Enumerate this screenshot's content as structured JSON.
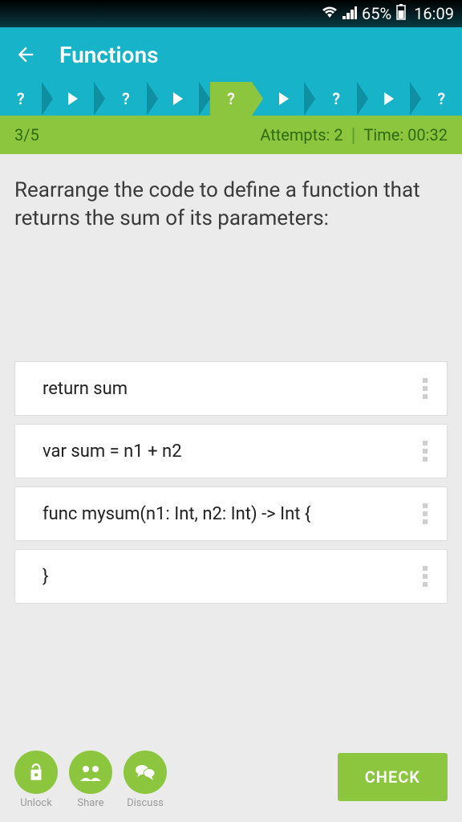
{
  "status": {
    "battery_pct": "65%",
    "time": "16:09"
  },
  "appbar": {
    "title": "Functions"
  },
  "stats": {
    "progress": "3/5",
    "attempts_label": "Attempts: 2",
    "time_label": "Time: 00:32"
  },
  "question": "Rearrange the code to define a function that returns the sum of its parameters:",
  "cards": [
    {
      "code": "return sum"
    },
    {
      "code": "var sum = n1 + n2"
    },
    {
      "code": "func mysum(n1: Int, n2: Int) -> Int {"
    },
    {
      "code": "}"
    }
  ],
  "bottom": {
    "unlock_label": "Unlock",
    "share_label": "Share",
    "discuss_label": "Discuss",
    "check_label": "CHECK"
  }
}
